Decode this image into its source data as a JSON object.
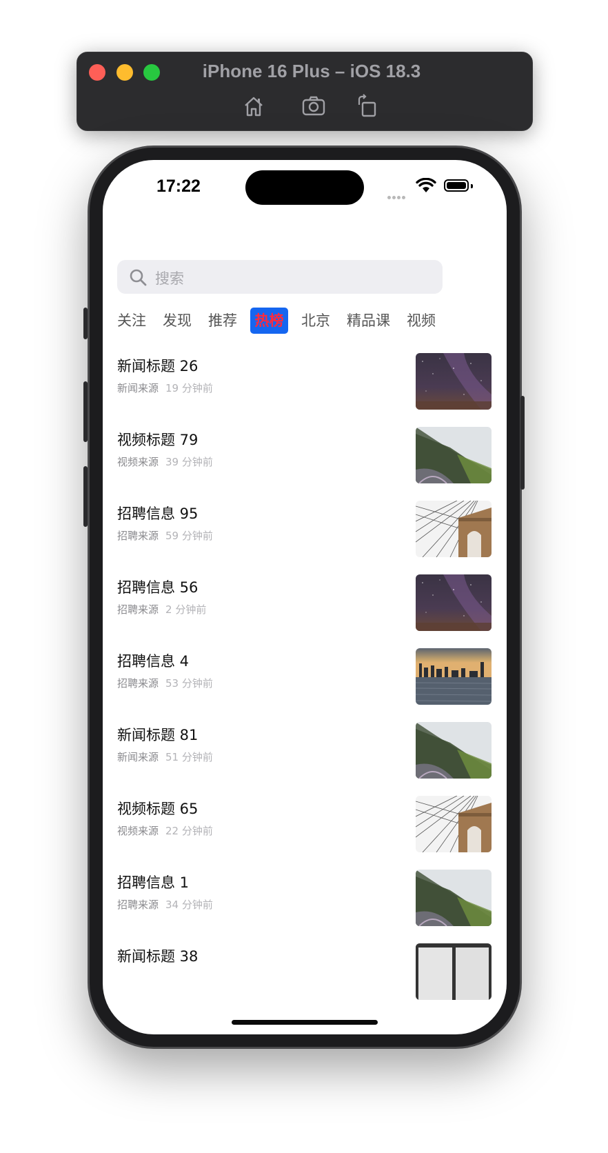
{
  "simulator": {
    "title": "iPhone 16 Plus – iOS 18.3",
    "tools": [
      "home-icon",
      "screenshot-icon",
      "rotate-icon"
    ]
  },
  "status_bar": {
    "time": "17:22"
  },
  "search": {
    "placeholder": "搜索"
  },
  "tabs": [
    {
      "label": "关注",
      "active": false
    },
    {
      "label": "发现",
      "active": false
    },
    {
      "label": "推荐",
      "active": false
    },
    {
      "label": "热榜",
      "active": true
    },
    {
      "label": "北京",
      "active": false
    },
    {
      "label": "精品课",
      "active": false
    },
    {
      "label": "视频",
      "active": false
    }
  ],
  "colors": {
    "active_tab_bg": "#1566f0",
    "active_tab_text": "#ff2a3c",
    "search_bg": "#eeeef2"
  },
  "items": [
    {
      "title": "新闻标题 26",
      "source": "新闻来源",
      "time": "19 分钟前",
      "image": "starry-sky"
    },
    {
      "title": "视频标题 79",
      "source": "视频来源",
      "time": "39 分钟前",
      "image": "mountain-road"
    },
    {
      "title": "招聘信息 95",
      "source": "招聘来源",
      "time": "59 分钟前",
      "image": "bridge-cables"
    },
    {
      "title": "招聘信息 56",
      "source": "招聘来源",
      "time": "2 分钟前",
      "image": "starry-sky"
    },
    {
      "title": "招聘信息 4",
      "source": "招聘来源",
      "time": "53 分钟前",
      "image": "city-skyline-water"
    },
    {
      "title": "新闻标题 81",
      "source": "新闻来源",
      "time": "51 分钟前",
      "image": "mountain-road"
    },
    {
      "title": "视频标题 65",
      "source": "视频来源",
      "time": "22 分钟前",
      "image": "bridge-cables"
    },
    {
      "title": "招聘信息 1",
      "source": "招聘来源",
      "time": "34 分钟前",
      "image": "mountain-road"
    },
    {
      "title": "新闻标题 38",
      "source": "",
      "time": "",
      "image": "window-frame"
    }
  ]
}
